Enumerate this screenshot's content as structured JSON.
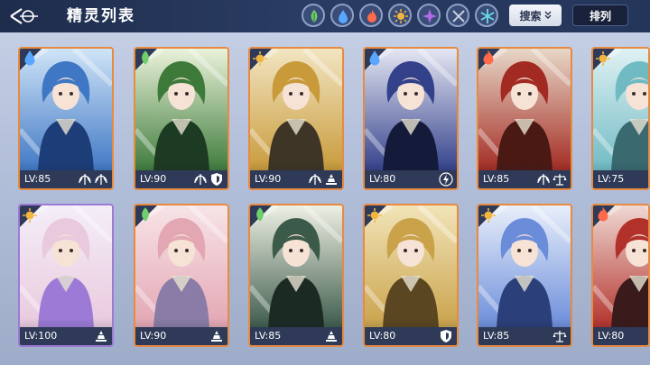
{
  "header": {
    "title": "精灵列表",
    "back_icon": "back-arrow-icon",
    "filters": [
      {
        "name": "filter-nature",
        "icon": "leaf-icon",
        "color": "#6fcf6a"
      },
      {
        "name": "filter-water",
        "icon": "water-drop-icon",
        "color": "#5aa6ff"
      },
      {
        "name": "filter-fire",
        "icon": "flame-icon",
        "color": "#ff6a4a"
      },
      {
        "name": "filter-light",
        "icon": "sun-icon",
        "color": "#f2b640"
      },
      {
        "name": "filter-dark",
        "icon": "dark-star-icon",
        "color": "#b06ae8"
      },
      {
        "name": "filter-neutral",
        "icon": "crossed-swords-icon",
        "color": "#c9d0de"
      },
      {
        "name": "filter-ice",
        "icon": "snowflake-icon",
        "color": "#6adbe8"
      }
    ],
    "search_label": "搜索",
    "sort_label": "排列"
  },
  "cards": [
    {
      "level": "LV:85",
      "element": "water",
      "frame": "orange",
      "skills": [
        "wings-icon",
        "wings-icon"
      ],
      "palette": [
        "#cfe4f7",
        "#3f77c4",
        "#1d3d78"
      ]
    },
    {
      "level": "LV:90",
      "element": "nature",
      "frame": "orange",
      "skills": [
        "wings-icon",
        "shield-icon"
      ],
      "palette": [
        "#eaf2da",
        "#3d7a3a",
        "#1d3a22"
      ]
    },
    {
      "level": "LV:90",
      "element": "light",
      "frame": "orange",
      "skills": [
        "wings-icon",
        "tower-icon"
      ],
      "palette": [
        "#f2e5c2",
        "#c89a3a",
        "#3e3526"
      ]
    },
    {
      "level": "LV:80",
      "element": "water",
      "frame": "orange",
      "skills": [
        "lightning-icon"
      ],
      "palette": [
        "#e4e6f2",
        "#33408a",
        "#141a3a"
      ]
    },
    {
      "level": "LV:85",
      "element": "fire",
      "frame": "orange",
      "skills": [
        "wings-icon",
        "scales-icon"
      ],
      "palette": [
        "#e7d7c7",
        "#a32a22",
        "#4a1914"
      ]
    },
    {
      "level": "LV:75",
      "element": "light",
      "frame": "orange",
      "skills": [
        "wings-icon"
      ],
      "palette": [
        "#dff1f3",
        "#6fbac3",
        "#3a6a70"
      ]
    },
    {
      "level": "LV:100",
      "element": "light",
      "frame": "purple",
      "skills": [
        "tower-icon"
      ],
      "palette": [
        "#f4eef8",
        "#e9c9dd",
        "#9c7ad6"
      ]
    },
    {
      "level": "LV:90",
      "element": "nature",
      "frame": "orange",
      "skills": [
        "tower-icon"
      ],
      "palette": [
        "#f7e4e7",
        "#e3a6b3",
        "#8a7ca6"
      ]
    },
    {
      "level": "LV:85",
      "element": "nature",
      "frame": "orange",
      "skills": [
        "tower-icon"
      ],
      "palette": [
        "#eef0e4",
        "#3c5a4a",
        "#1b2b24"
      ]
    },
    {
      "level": "LV:80",
      "element": "light",
      "frame": "orange",
      "skills": [
        "shield-icon"
      ],
      "palette": [
        "#f2e4b8",
        "#c9a24a",
        "#5a4620"
      ]
    },
    {
      "level": "LV:85",
      "element": "light",
      "frame": "orange",
      "skills": [
        "scales-icon"
      ],
      "palette": [
        "#e8effa",
        "#6a8cd9",
        "#2b3f7a"
      ]
    },
    {
      "level": "LV:80",
      "element": "fire",
      "frame": "orange",
      "skills": [
        "tower-icon"
      ],
      "palette": [
        "#efd8d2",
        "#b2312a",
        "#3a1a1a"
      ]
    }
  ]
}
